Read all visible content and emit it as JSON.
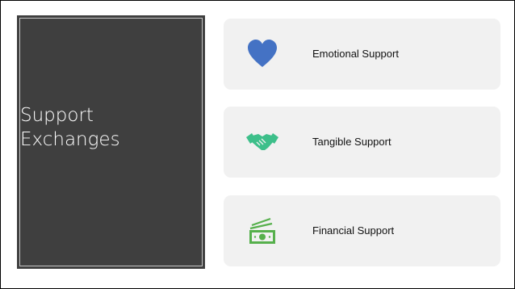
{
  "title": "Support\nExchanges",
  "cards": [
    {
      "label": "Emotional Support",
      "icon": "heart-icon",
      "color": "#4472c4"
    },
    {
      "label": "Tangible Support",
      "icon": "handshake-icon",
      "color": "#3dbf8a"
    },
    {
      "label": "Financial Support",
      "icon": "money-icon",
      "color": "#56b04c"
    }
  ],
  "colors": {
    "panel": "#3f3f3f",
    "card": "#f1f1f1"
  }
}
